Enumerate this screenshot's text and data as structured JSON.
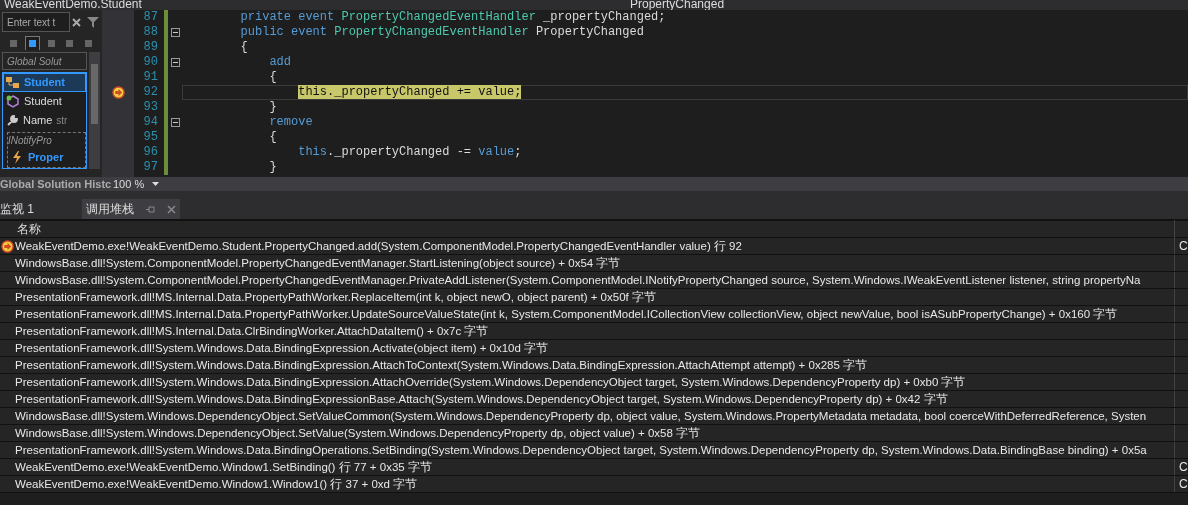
{
  "title_bar": {
    "document": "WeakEventDemo.Student",
    "member": "PropertyChanged"
  },
  "class_view": {
    "search_placeholder": "Enter text t",
    "tabs": [
      {
        "selected": false
      },
      {
        "selected": true
      },
      {
        "selected": false
      },
      {
        "selected": false
      },
      {
        "selected": false
      }
    ],
    "scope": "Global Solut",
    "tree": [
      {
        "label": "Student",
        "selected": true,
        "kind": "class",
        "children": [
          {
            "label": "Student",
            "selected": false,
            "kind": "constructor"
          },
          {
            "label": "Name",
            "detail": "str",
            "selected": false,
            "kind": "property"
          },
          {
            "label": "INotifyPro",
            "selected": false,
            "kind": "group",
            "children": [
              {
                "label": "Proper",
                "selected": false,
                "kind": "event"
              }
            ]
          }
        ]
      }
    ],
    "footer": "Global Solution Histc"
  },
  "editor": {
    "zoom": "100 %",
    "lines": [
      {
        "number": "87",
        "fold": false,
        "current": false,
        "tokens": [
          {
            "text": "        private event ",
            "kind": "keyword"
          },
          {
            "text": "PropertyChangedEventHandler",
            "kind": "type"
          },
          {
            "text": " _propertyChanged;",
            "kind": "plain"
          }
        ]
      },
      {
        "number": "88",
        "fold": true,
        "current": false,
        "tokens": [
          {
            "text": "        public event ",
            "kind": "keyword"
          },
          {
            "text": "PropertyChangedEventHandler",
            "kind": "type"
          },
          {
            "text": " PropertyChanged",
            "kind": "plain"
          }
        ]
      },
      {
        "number": "89",
        "fold": false,
        "current": false,
        "tokens": [
          {
            "text": "        {",
            "kind": "plain"
          }
        ]
      },
      {
        "number": "90",
        "fold": true,
        "current": false,
        "tokens": [
          {
            "text": "            add",
            "kind": "keyword"
          }
        ]
      },
      {
        "number": "91",
        "fold": false,
        "current": false,
        "tokens": [
          {
            "text": "            {",
            "kind": "plain"
          }
        ]
      },
      {
        "number": "92",
        "fold": false,
        "current": true,
        "tokens": [
          {
            "text": "                this._propertyChanged += value;",
            "kind": "plain"
          }
        ]
      },
      {
        "number": "93",
        "fold": false,
        "current": false,
        "tokens": [
          {
            "text": "            }",
            "kind": "plain"
          }
        ]
      },
      {
        "number": "94",
        "fold": true,
        "current": false,
        "tokens": [
          {
            "text": "            remove",
            "kind": "keyword"
          }
        ]
      },
      {
        "number": "95",
        "fold": false,
        "current": false,
        "tokens": [
          {
            "text": "            {",
            "kind": "plain"
          }
        ]
      },
      {
        "number": "96",
        "fold": false,
        "current": false,
        "tokens": [
          {
            "text": "                this",
            "kind": "keyword"
          },
          {
            "text": "._propertyChanged -= ",
            "kind": "plain"
          },
          {
            "text": "value",
            "kind": "keyword"
          },
          {
            "text": ";",
            "kind": "plain"
          }
        ]
      },
      {
        "number": "97",
        "fold": false,
        "current": false,
        "tokens": [
          {
            "text": "            }",
            "kind": "plain"
          }
        ]
      }
    ]
  },
  "tool_tabs": [
    {
      "label": "监视 1",
      "selected": false
    },
    {
      "label": "调用堆栈",
      "selected": true
    }
  ],
  "call_stack": {
    "columns": [
      "名称"
    ],
    "rows": [
      {
        "name": "WeakEventDemo.exe!WeakEventDemo.Student.PropertyChanged.add(System.ComponentModel.PropertyChangedEventHandler value) 行 92",
        "language": "C",
        "current": true
      },
      {
        "name": "WindowsBase.dll!System.ComponentModel.PropertyChangedEventManager.StartListening(object source) + 0x54 字节",
        "current": false
      },
      {
        "name": "WindowsBase.dll!System.ComponentModel.PropertyChangedEventManager.PrivateAddListener(System.ComponentModel.INotifyPropertyChanged source, System.Windows.IWeakEventListener listener, string propertyNa",
        "current": false
      },
      {
        "name": "PresentationFramework.dll!MS.Internal.Data.PropertyPathWorker.ReplaceItem(int k, object newO, object parent) + 0x50f 字节",
        "current": false
      },
      {
        "name": "PresentationFramework.dll!MS.Internal.Data.PropertyPathWorker.UpdateSourceValueState(int k, System.ComponentModel.ICollectionView collectionView, object newValue, bool isASubPropertyChange) + 0x160 字节",
        "current": false
      },
      {
        "name": "PresentationFramework.dll!MS.Internal.Data.ClrBindingWorker.AttachDataItem() + 0x7c 字节",
        "current": false
      },
      {
        "name": "PresentationFramework.dll!System.Windows.Data.BindingExpression.Activate(object item) + 0x10d 字节",
        "current": false
      },
      {
        "name": "PresentationFramework.dll!System.Windows.Data.BindingExpression.AttachToContext(System.Windows.Data.BindingExpression.AttachAttempt attempt) + 0x285 字节",
        "current": false
      },
      {
        "name": "PresentationFramework.dll!System.Windows.Data.BindingExpression.AttachOverride(System.Windows.DependencyObject target, System.Windows.DependencyProperty dp) + 0xb0 字节",
        "current": false
      },
      {
        "name": "PresentationFramework.dll!System.Windows.Data.BindingExpressionBase.Attach(System.Windows.DependencyObject target, System.Windows.DependencyProperty dp) + 0x42 字节",
        "current": false
      },
      {
        "name": "WindowsBase.dll!System.Windows.DependencyObject.SetValueCommon(System.Windows.DependencyProperty dp, object value, System.Windows.PropertyMetadata metadata, bool coerceWithDeferredReference, Systen",
        "current": false
      },
      {
        "name": "WindowsBase.dll!System.Windows.DependencyObject.SetValue(System.Windows.DependencyProperty dp, object value) + 0x58 字节",
        "current": false
      },
      {
        "name": "PresentationFramework.dll!System.Windows.Data.BindingOperations.SetBinding(System.Windows.DependencyObject target, System.Windows.DependencyProperty dp, System.Windows.Data.BindingBase binding) + 0x5a",
        "current": false
      },
      {
        "name": "WeakEventDemo.exe!WeakEventDemo.Window1.SetBinding() 行 77 + 0x35 字节",
        "language": "C",
        "current": false
      },
      {
        "name": "WeakEventDemo.exe!WeakEventDemo.Window1.Window1() 行 37 + 0xd 字节",
        "language": "C",
        "current": false
      }
    ]
  }
}
